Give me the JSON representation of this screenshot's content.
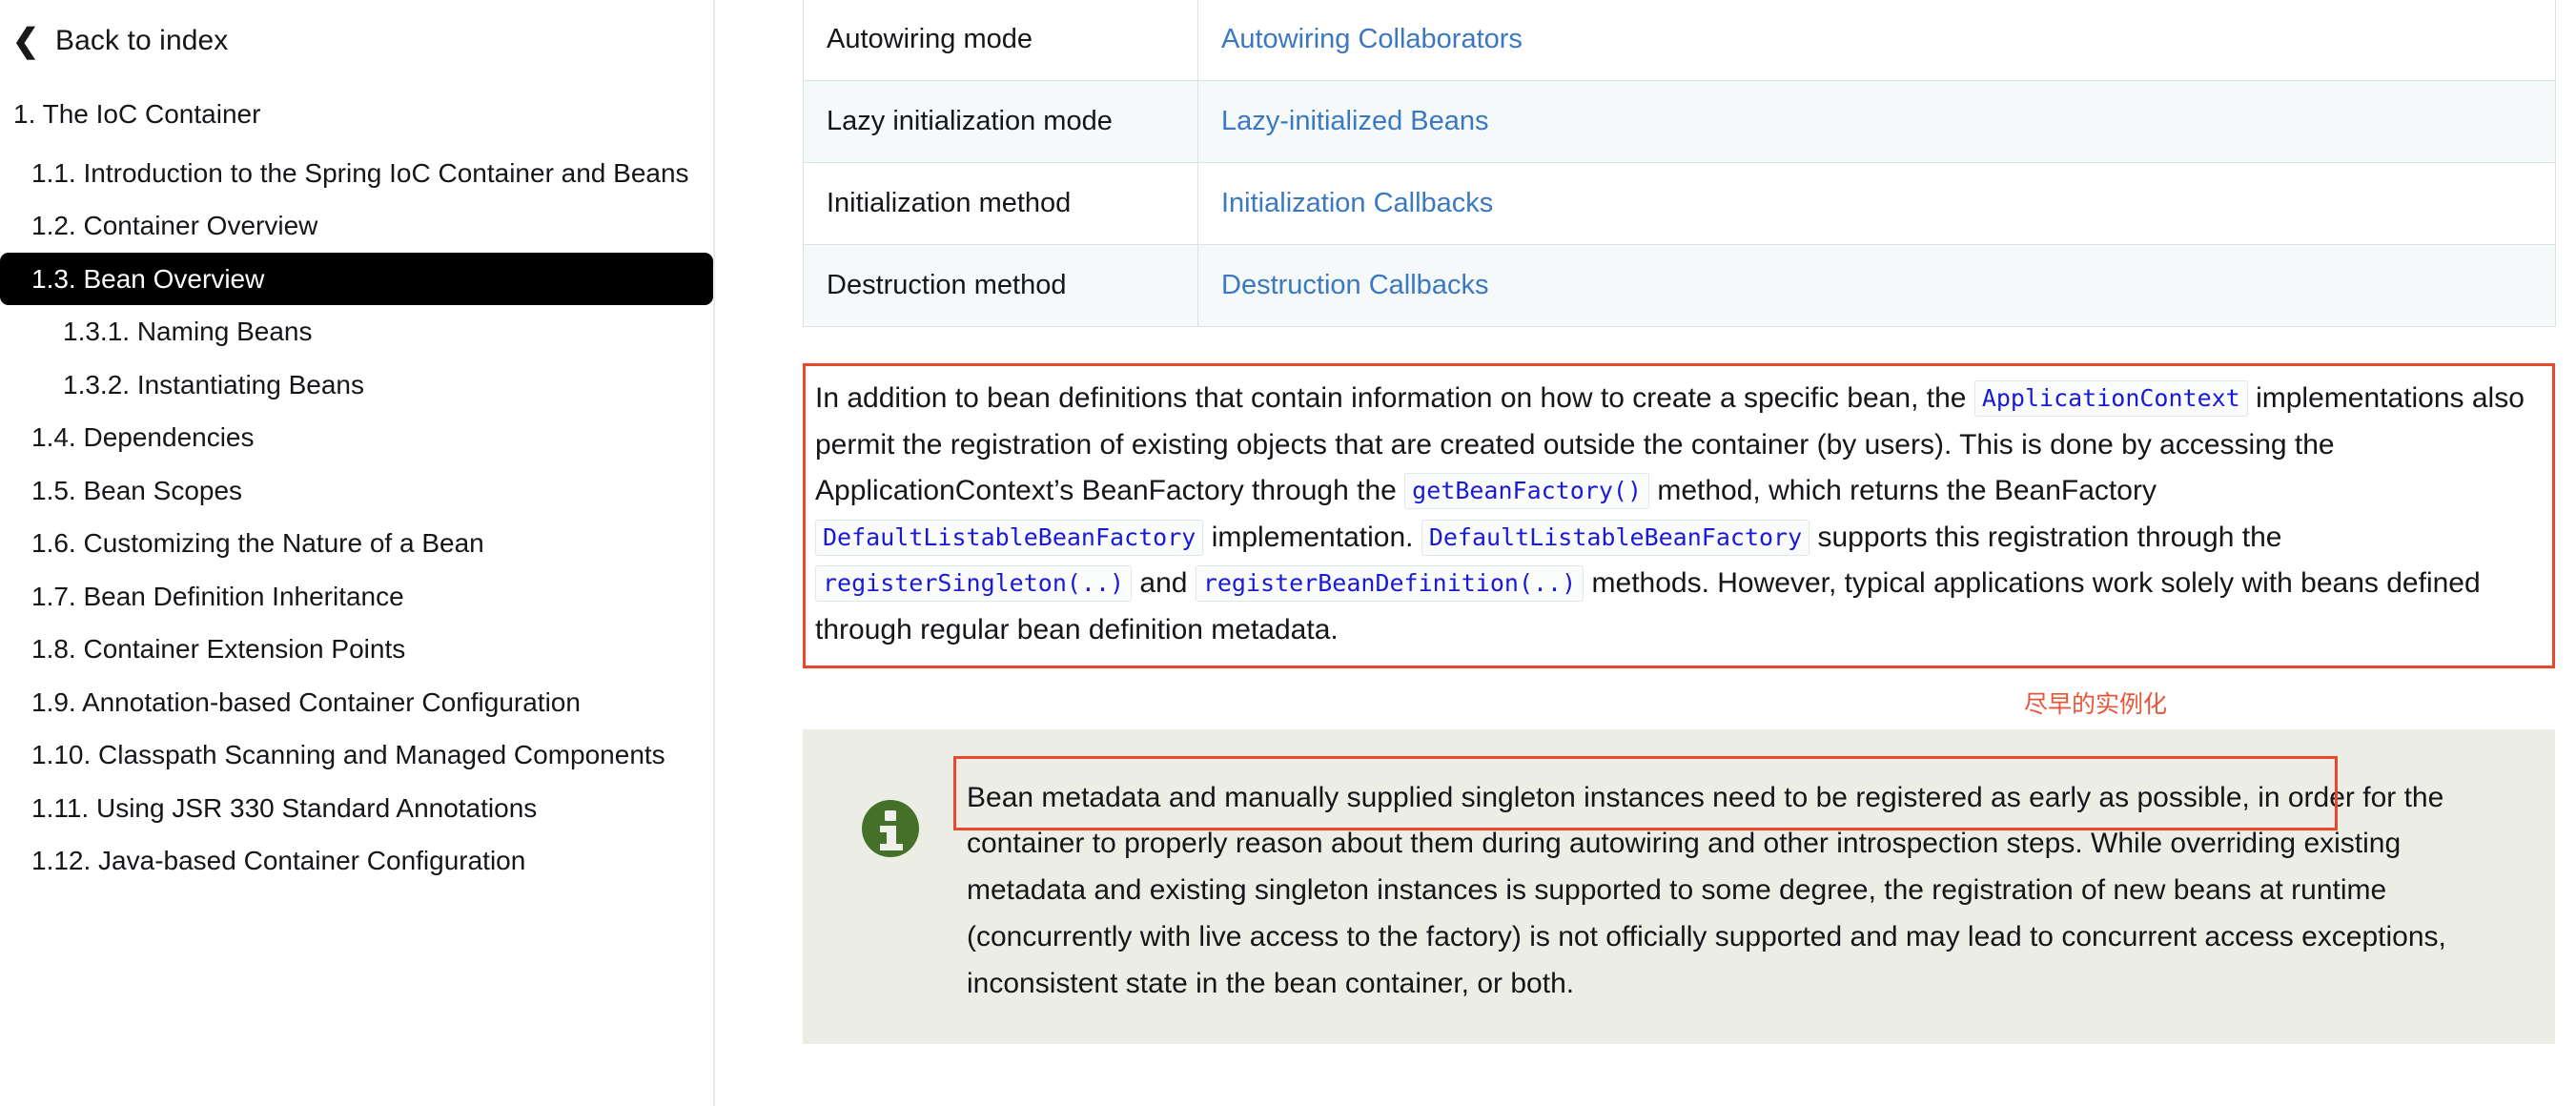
{
  "sidebar": {
    "back_label": "Back to index",
    "back_icon": "chevron-left-icon",
    "items": [
      {
        "label": "1. The IoC Container",
        "level": 1,
        "active": false
      },
      {
        "label": "1.1. Introduction to the Spring IoC Container and Beans",
        "level": 2,
        "active": false
      },
      {
        "label": "1.2. Container Overview",
        "level": 2,
        "active": false
      },
      {
        "label": "1.3. Bean Overview",
        "level": 2,
        "active": true
      },
      {
        "label": "1.3.1. Naming Beans",
        "level": 3,
        "active": false
      },
      {
        "label": "1.3.2. Instantiating Beans",
        "level": 3,
        "active": false
      },
      {
        "label": "1.4. Dependencies",
        "level": 2,
        "active": false
      },
      {
        "label": "1.5. Bean Scopes",
        "level": 2,
        "active": false
      },
      {
        "label": "1.6. Customizing the Nature of a Bean",
        "level": 2,
        "active": false
      },
      {
        "label": "1.7. Bean Definition Inheritance",
        "level": 2,
        "active": false
      },
      {
        "label": "1.8. Container Extension Points",
        "level": 2,
        "active": false
      },
      {
        "label": "1.9. Annotation-based Container Configuration",
        "level": 2,
        "active": false
      },
      {
        "label": "1.10. Classpath Scanning and Managed Components",
        "level": 2,
        "active": false
      },
      {
        "label": "1.11. Using JSR 330 Standard Annotations",
        "level": 2,
        "active": false
      },
      {
        "label": "1.12. Java-based Container Configuration",
        "level": 2,
        "active": false
      }
    ]
  },
  "table": {
    "rows": [
      {
        "property": "",
        "link": "",
        "clipped": true
      },
      {
        "property": "Autowiring mode",
        "link": "Autowiring Collaborators",
        "clipped": false
      },
      {
        "property": "Lazy initialization mode",
        "link": "Lazy-initialized Beans",
        "clipped": false
      },
      {
        "property": "Initialization method",
        "link": "Initialization Callbacks",
        "clipped": false
      },
      {
        "property": "Destruction method",
        "link": "Destruction Callbacks",
        "clipped": false
      }
    ]
  },
  "paragraph": {
    "seg1": "In addition to bean definitions that contain information on how to create a specific bean, the",
    "code1": "ApplicationContext",
    "seg2": "implementations also permit the registration of existing objects that are created outside the container (by users). This is done by accessing the ApplicationContext’s BeanFactory through the",
    "code2": "getBeanFactory()",
    "seg3": "method, which returns the BeanFactory",
    "code3": "DefaultListableBeanFactory",
    "seg4": "implementation.",
    "code4": "DefaultListableBeanFactory",
    "seg5": "supports this registration through the",
    "code5": "registerSingleton(..)",
    "seg6": "and",
    "code6": "registerBeanDefinition(..)",
    "seg7": "methods. However, typical applications work solely with beans defined through regular bean definition metadata."
  },
  "annotation": {
    "cn_note": "尽早的实例化",
    "highlight_color": "#e8482b"
  },
  "callout": {
    "icon": "info-icon",
    "icon_color": "#44702a",
    "background": "#eceee6",
    "text": "Bean metadata and manually supplied singleton instances need to be registered as early as possible, in order for the container to properly reason about them during autowiring and other introspection steps. While overriding existing metadata and existing singleton instances is supported to some degree, the registration of new beans at runtime (concurrently with live access to the factory) is not officially supported and may lead to concurrent access exceptions, inconsistent state in the bean container, or both."
  }
}
